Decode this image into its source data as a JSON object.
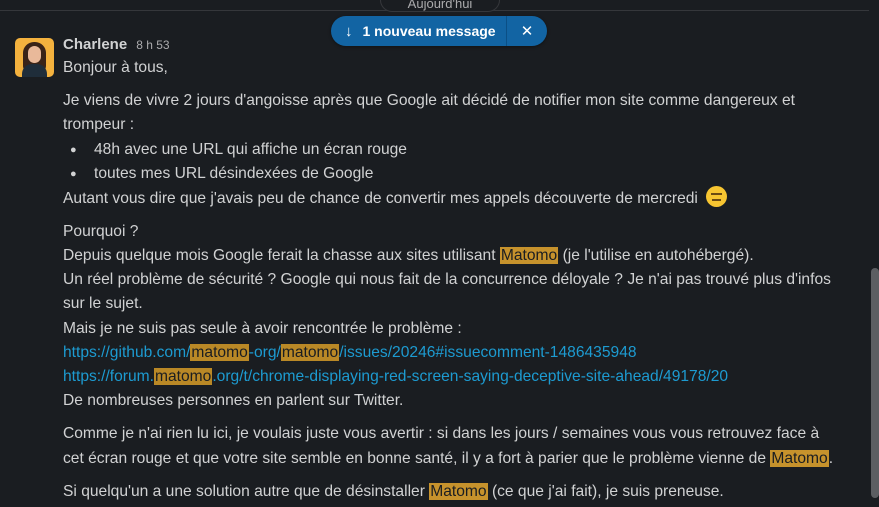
{
  "date_divider": "Aujourd'hui",
  "banner": {
    "label": "1 nouveau message"
  },
  "message": {
    "author": "Charlene",
    "time": "8 h 53",
    "greeting": "Bonjour à tous,",
    "para1_a": "Je viens de vivre 2 jours d'angoisse après que Google ait décidé de notifier mon site comme dangereux et",
    "para1_b": "trompeur :",
    "bullets": [
      "48h avec une URL qui affiche un écran rouge",
      "toutes mes URL désindexées de Google"
    ],
    "para2": "Autant vous dire que j'avais peu de chance de convertir mes appels découverte de mercredi",
    "pourquoi": "Pourquoi ?",
    "line_depuis_pre": "Depuis quelque mois Google ferait la chasse aux sites utilisant",
    "keyword": "Matomo",
    "line_depuis_post": "(je l'utilise en autohébergé).",
    "line_probleme_a": "Un réel problème de sécurité ? Google qui nous fait de la concurrence déloyale ? Je n'ai pas trouvé plus d'infos",
    "line_probleme_b": "sur le sujet.",
    "line_seule": "Mais je ne suis pas seule à avoir rencontrée le problème :",
    "link1": {
      "p1": "https://github.com/",
      "k1": "matomo",
      "p2": "-org/",
      "k2": "matomo",
      "p3": "/issues/20246#issuecomment-1486435948"
    },
    "link2": {
      "p1": "https://forum.",
      "k1": "matomo",
      "p2": ".org/t/chrome-displaying-red-screen-saying-deceptive-site-ahead/49178/20"
    },
    "line_twitter": "De nombreuses personnes en parlent sur Twitter.",
    "para_comme_a": "Comme je n'ai rien lu ici, je voulais juste vous avertir : si dans les jours / semaines vous vous retrouvez face à",
    "para_comme_b": "cet écran rouge et que votre site semble en bonne santé, il y a fort à parier que le problème vienne de",
    "para_comme_end": ".",
    "para_si_pre": "Si quelqu'un a une solution autre que de désinstaller",
    "para_si_post": "(ce que j'ai fait), je suis preneuse."
  },
  "colors": {
    "background": "#1a1d21",
    "text": "#d1d2d3",
    "link": "#1d9bd1",
    "highlight": "#c6922c",
    "banner": "#1264a3"
  },
  "icons": {
    "banner_arrow": "arrow-down-icon",
    "banner_close": "close-icon",
    "emoji": "expressionless-face-icon"
  }
}
